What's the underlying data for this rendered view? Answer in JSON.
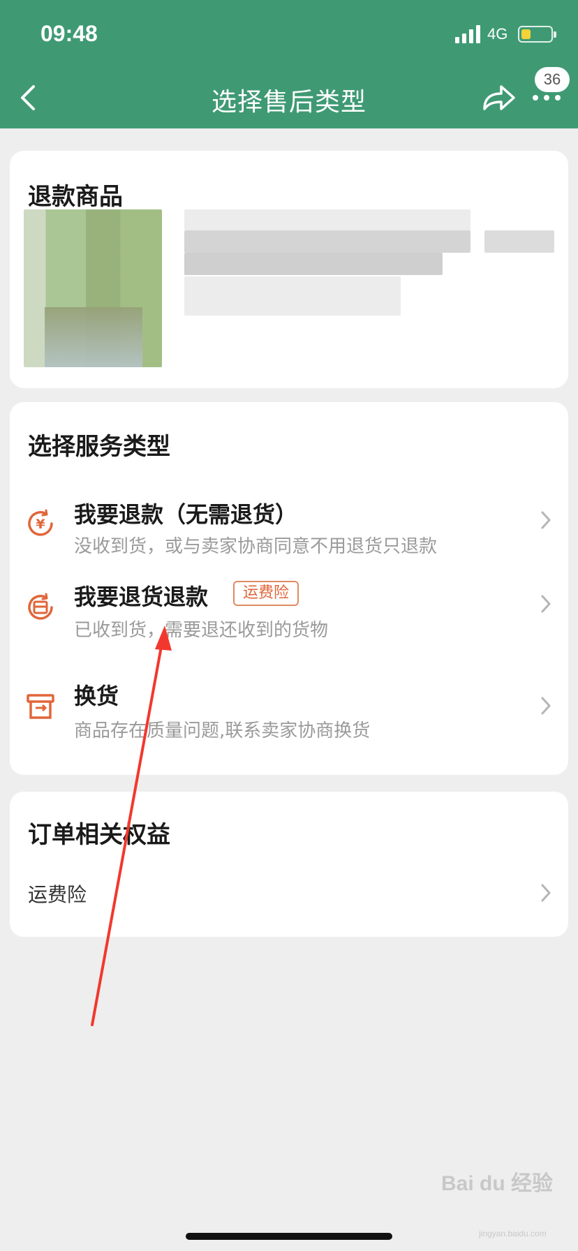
{
  "status_bar": {
    "time": "09:48",
    "network": "4G",
    "battery_level": 0.3
  },
  "nav": {
    "title": "选择售后类型",
    "badge_count": "36",
    "back_icon": "chevron-left-icon",
    "share_icon": "share-icon",
    "more_icon": "more-dots-icon"
  },
  "refund_product": {
    "title": "退款商品"
  },
  "service_type": {
    "title": "选择服务类型",
    "options": [
      {
        "label": "我要退款（无需退货）",
        "desc": "没收到货，或与卖家协商同意不用退货只退款",
        "icon": "yuan-refund-icon"
      },
      {
        "label": "我要退货退款",
        "tag": "运费险",
        "desc": "已收到货，需要退还收到的货物",
        "icon": "return-package-icon"
      },
      {
        "label": "换货",
        "desc": "商品存在质量问题,联系卖家协商换货",
        "icon": "exchange-box-icon"
      }
    ]
  },
  "order_benefits": {
    "title": "订单相关权益",
    "items": [
      {
        "label": "运费险"
      }
    ]
  },
  "watermark": {
    "brand": "Bai du 经验",
    "url": "jingyan.baidu.com"
  },
  "colors": {
    "header_bg": "#3f9a74",
    "accent_orange": "#e0663a",
    "annotation_arrow": "#f2382e"
  }
}
